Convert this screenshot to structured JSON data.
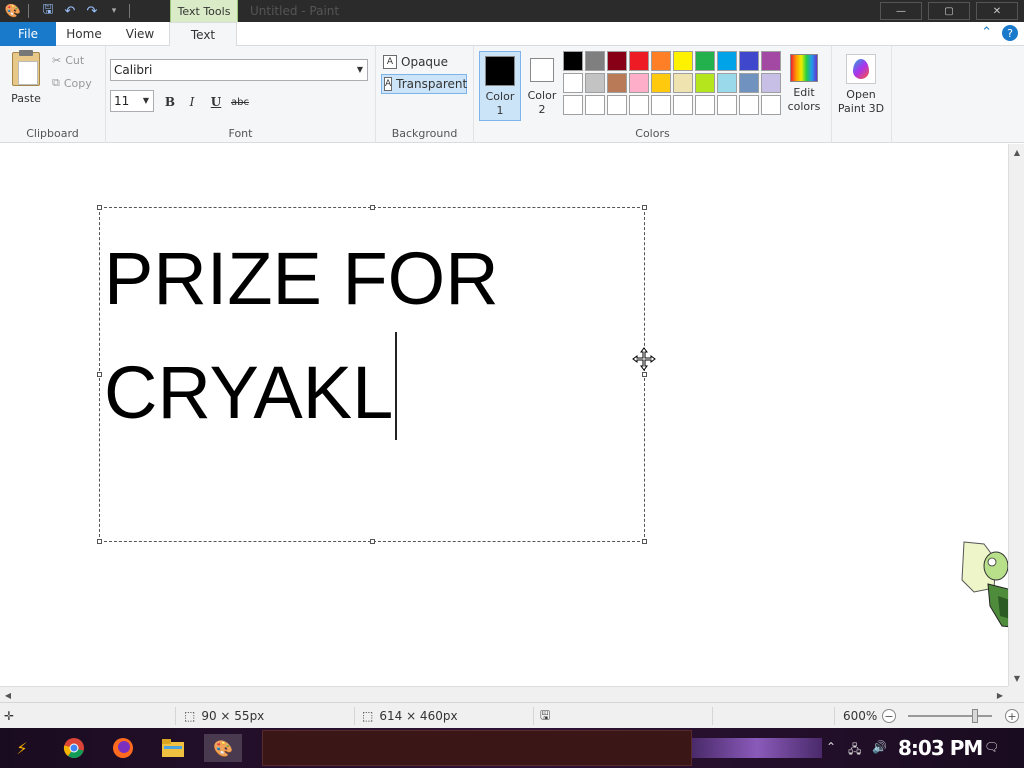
{
  "window": {
    "title": "Untitled - Paint",
    "context_tab": "Text Tools",
    "minimize": "—",
    "maximize": "▢",
    "close": "✕"
  },
  "tabs": {
    "file": "File",
    "home": "Home",
    "view": "View",
    "text": "Text"
  },
  "clipboard": {
    "paste": "Paste",
    "cut": "Cut",
    "copy": "Copy",
    "group_label": "Clipboard"
  },
  "font": {
    "family": "Calibri",
    "size": "11",
    "bold": "B",
    "italic": "I",
    "underline": "U",
    "strikethrough": "abc",
    "group_label": "Font"
  },
  "background": {
    "opaque": "Opaque",
    "transparent": "Transparent",
    "selected": "Transparent",
    "group_label": "Background"
  },
  "colors": {
    "color1_label": "Color\n1",
    "color2_label": "Color\n2",
    "color1": "#000000",
    "color2": "#ffffff",
    "edit_colors": "Edit colors",
    "open_paint3d": "Open Paint 3D",
    "group_label": "Colors",
    "palette": [
      "#000000",
      "#7f7f7f",
      "#880015",
      "#ed1c24",
      "#ff7f27",
      "#fff200",
      "#22b14c",
      "#00a2e8",
      "#3f48cc",
      "#a349a4",
      "#ffffff",
      "#c3c3c3",
      "#b97a57",
      "#ffaec9",
      "#ffc90e",
      "#efe4b0",
      "#b5e61d",
      "#99d9ea",
      "#7092be",
      "#c8bfe7",
      "#ffffff",
      "#ffffff",
      "#ffffff",
      "#ffffff",
      "#ffffff",
      "#ffffff",
      "#ffffff",
      "#ffffff",
      "#ffffff",
      "#ffffff"
    ]
  },
  "canvas": {
    "text_line1": "PRIZE FOR",
    "text_line2": "CRYAKL"
  },
  "status": {
    "selection_size": "90 × 55px",
    "canvas_size": "614 × 460px",
    "zoom": "600%",
    "zoom_level_fraction": 0.8
  },
  "taskbar": {
    "time": "8:03 PM"
  }
}
